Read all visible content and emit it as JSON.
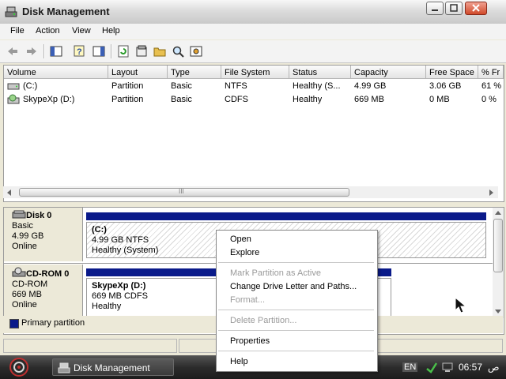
{
  "window": {
    "title": "Disk Management"
  },
  "menu": [
    "File",
    "Action",
    "View",
    "Help"
  ],
  "toolbar_icons": [
    "back-arrow-icon",
    "forward-arrow-icon",
    "show-hide-console-tree-icon",
    "help-icon",
    "export-list-icon",
    "refresh-icon",
    "properties-icon",
    "open-folder-icon",
    "search-icon",
    "settings-icon"
  ],
  "volume_list": {
    "columns": [
      "Volume",
      "Layout",
      "Type",
      "File System",
      "Status",
      "Capacity",
      "Free Space",
      "% Fr"
    ],
    "rows": [
      {
        "volume": "(C:)",
        "icon": "drive-icon",
        "layout": "Partition",
        "type": "Basic",
        "fs": "NTFS",
        "status": "Healthy (S...",
        "capacity": "4.99 GB",
        "free": "3.06 GB",
        "pct": "61 %"
      },
      {
        "volume": "SkypeXp (D:)",
        "icon": "cd-drive-icon",
        "layout": "Partition",
        "type": "Basic",
        "fs": "CDFS",
        "status": "Healthy",
        "capacity": "669 MB",
        "free": "0 MB",
        "pct": "0 %"
      }
    ],
    "scroll_grip": "III"
  },
  "disks": [
    {
      "name": "Disk 0",
      "icon": "hard-disk-icon",
      "kind": "Basic",
      "size": "4.99 GB",
      "state": "Online",
      "partition": {
        "label": "(C:)",
        "detail": "4.99 GB NTFS",
        "status": "Healthy (System)"
      }
    },
    {
      "name": "CD-ROM 0",
      "icon": "cd-rom-icon",
      "kind": "CD-ROM",
      "size": "669 MB",
      "state": "Online",
      "partition": {
        "label": "SkypeXp  (D:)",
        "detail": "669 MB CDFS",
        "status": "Healthy"
      }
    }
  ],
  "legend": {
    "label": "Primary partition",
    "color": "#0a1a8a"
  },
  "context_menu": {
    "items": [
      {
        "label": "Open",
        "enabled": true
      },
      {
        "label": "Explore",
        "enabled": true
      },
      {
        "label": "Mark Partition as Active",
        "enabled": false
      },
      {
        "label": "Change Drive Letter and Paths...",
        "enabled": true
      },
      {
        "label": "Format...",
        "enabled": false
      },
      {
        "label": "Delete Partition...",
        "enabled": false
      },
      {
        "label": "Properties",
        "enabled": true
      },
      {
        "label": "Help",
        "enabled": true
      }
    ]
  },
  "taskbar": {
    "task_label": "Disk Management",
    "language": "EN",
    "clock": "06:57",
    "clock_suffix": "ص"
  }
}
